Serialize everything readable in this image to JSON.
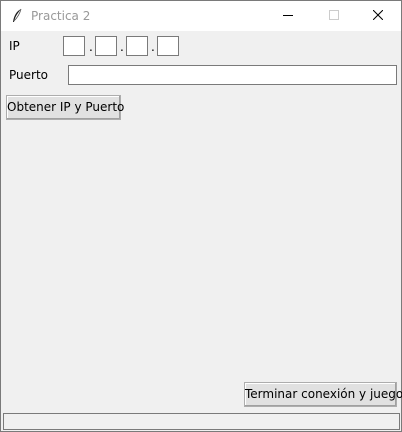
{
  "window": {
    "title": "Practica 2",
    "app_icon": "feather-icon"
  },
  "form": {
    "ip_label": "IP",
    "ip_separator": ".",
    "ip_octets": [
      "",
      "",
      "",
      ""
    ],
    "port_label": "Puerto",
    "port_value": ""
  },
  "buttons": {
    "get_label": "Obtener IP y Puerto",
    "end_label": "Terminar conexión y juego"
  },
  "titlebar_controls": [
    "minimize-icon",
    "maximize-icon",
    "close-icon"
  ]
}
